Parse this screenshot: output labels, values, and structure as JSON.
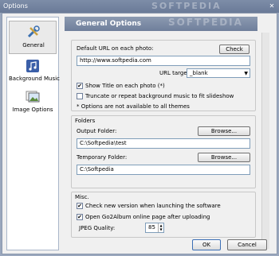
{
  "window": {
    "title": "Options",
    "watermark": "SOFTPEDIA",
    "close_label": "✕"
  },
  "sidebar": {
    "items": [
      {
        "label": "General",
        "icon": "tools-icon",
        "active": true
      },
      {
        "label": "Background Music",
        "icon": "music-icon",
        "active": false
      },
      {
        "label": "Image Options",
        "icon": "image-icon",
        "active": false
      }
    ]
  },
  "header": {
    "title": "General Options",
    "watermark": "SOFTPEDIA"
  },
  "general": {
    "default_url_label": "Default URL on each photo:",
    "check_button": "Check",
    "url_value": "http://www.softpedia.com",
    "url_target_label": "URL target:",
    "url_target_value": "_blank",
    "show_title_label": "Show Title on each photo (*)",
    "show_title_checked": true,
    "truncate_label": "Truncate or repeat background music to fit slideshow",
    "truncate_checked": false,
    "note": "* Options are not available to all themes"
  },
  "folders": {
    "group_label": "Folders",
    "output_label": "Output Folder:",
    "output_value": "C:\\Softpedia\\test",
    "temp_label": "Temporary Folder:",
    "temp_value": "C:\\Softpedia",
    "browse_label": "Browse..."
  },
  "misc": {
    "group_label": "Misc.",
    "check_version_label": "Check new version when launching the software",
    "check_version_checked": true,
    "open_page_label": "Open Go2Album online page after uploading",
    "open_page_checked": true,
    "jpeg_label": "JPEG Quality:",
    "jpeg_value": "85"
  },
  "footer": {
    "ok": "OK",
    "cancel": "Cancel"
  }
}
